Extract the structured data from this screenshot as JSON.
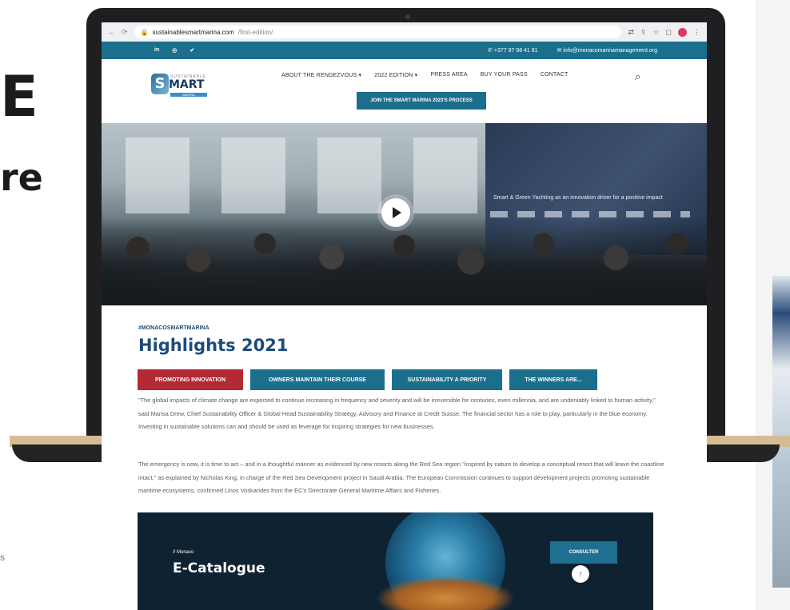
{
  "background": {
    "big_letter": "E",
    "big_word": "re",
    "small_mark": "s"
  },
  "browser": {
    "back_icon": "arrow-left-icon",
    "reload_icon": "reload-icon",
    "url_host": "sustainablesmartmarina.com",
    "url_path": "/first-edition/",
    "toolbar_icons": [
      "translate-icon",
      "share-icon",
      "star-icon",
      "window-icon",
      "profile-icon",
      "menu-icon"
    ]
  },
  "topbar": {
    "social": [
      "in",
      "◎",
      "✔"
    ],
    "phone": "+377 97 98 41 81",
    "email": "info@monacomarinamanagement.org",
    "color": "#1c6f8c"
  },
  "header": {
    "logo": {
      "letter": "S",
      "top_text": "SUSTAINABLE",
      "main_text": "MART",
      "bar_text": "MARINA"
    },
    "nav": [
      "ABOUT THE RENDEZVOUS ▾",
      "2022 EDITION ▾",
      "PRESS AREA",
      "BUY YOUR PASS",
      "CONTACT"
    ],
    "search_icon": "search-icon",
    "cta": "JOIN THE SMART MARINA 2023'S PROCESS"
  },
  "hero": {
    "screen_caption": "Smart & Green Yachting as an innovation driver for a positive impact",
    "play_icon": "play-icon"
  },
  "highlights": {
    "hashtag": "#MONACOSMARTMARINA",
    "title": "Highlights 2021",
    "tabs": [
      "PROMOTING INNOVATION",
      "OWNERS MAINTAIN THEIR COURSE",
      "SUSTAINABILITY A PRIORITY",
      "THE WINNERS ARE..."
    ],
    "active_tab_color": "#b32a33",
    "paragraph_1": "\"The global impacts of climate change are expected to continue increasing in frequency and severity and will be irreversible for centuries, even millennia, and are undeniably linked to human activity,\" said Marisa Drew, Chief Sustainability Officer & Global Head Sustainability Strategy, Advisory and Finance at Credit Suisse. The financial sector has a role to play, particularly in the blue economy. Investing in sustainable solutions can and should be used as leverage for inspiring strategies for new businesses.",
    "paragraph_2": "The emergency is now, it is time to act – and in a thoughtful manner as evidenced by new resorts along the Red Sea region \"inspired by nature to develop a conceptual resort that will leave the coastline intact,\" as explained by Nicholas King, in charge of the Red Sea Development project in Saudi Arabia. The European Commission continues to support development projects promoting sustainable maritime ecosystems, confirmed Linos Voskarides from the EC's Directorate General Maritime Affairs and Fisheries."
  },
  "catalogue": {
    "small": "// Monaco",
    "title": "E-Catalogue",
    "button": "CONSULTER"
  },
  "back_to_top": "↑"
}
